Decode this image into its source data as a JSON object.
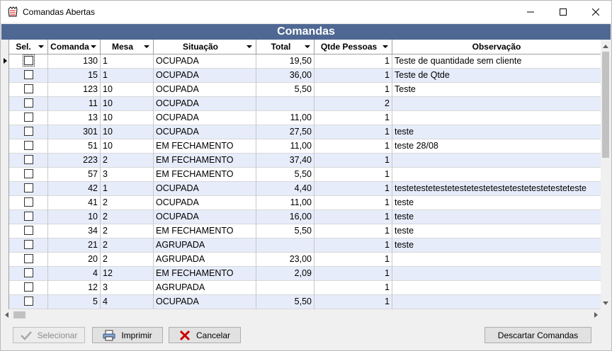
{
  "window": {
    "title": "Comandas Abertas",
    "minimize_glyph": "—",
    "maximize_glyph": "☐",
    "close_glyph": "✕"
  },
  "banner": {
    "title": "Comandas"
  },
  "grid": {
    "columns": [
      {
        "label": "Sel.",
        "dropdown": true
      },
      {
        "label": "Comanda",
        "dropdown": true
      },
      {
        "label": "Mesa",
        "dropdown": true
      },
      {
        "label": "Situação",
        "dropdown": true
      },
      {
        "label": "Total",
        "dropdown": true
      },
      {
        "label": "Qtde Pessoas",
        "dropdown": true
      },
      {
        "label": "Observação",
        "dropdown": false
      }
    ],
    "rows": [
      {
        "comanda": "130",
        "mesa": "1",
        "situacao": "OCUPADA",
        "total": "19,50",
        "pessoas": "1",
        "obs": "Teste de quantidade sem cliente"
      },
      {
        "comanda": "15",
        "mesa": "1",
        "situacao": "OCUPADA",
        "total": "36,00",
        "pessoas": "1",
        "obs": "Teste de Qtde"
      },
      {
        "comanda": "123",
        "mesa": "10",
        "situacao": "OCUPADA",
        "total": "5,50",
        "pessoas": "1",
        "obs": "Teste"
      },
      {
        "comanda": "11",
        "mesa": "10",
        "situacao": "OCUPADA",
        "total": "",
        "pessoas": "2",
        "obs": ""
      },
      {
        "comanda": "13",
        "mesa": "10",
        "situacao": "OCUPADA",
        "total": "11,00",
        "pessoas": "1",
        "obs": ""
      },
      {
        "comanda": "301",
        "mesa": "10",
        "situacao": "OCUPADA",
        "total": "27,50",
        "pessoas": "1",
        "obs": "teste"
      },
      {
        "comanda": "51",
        "mesa": "10",
        "situacao": "EM FECHAMENTO",
        "total": "11,00",
        "pessoas": "1",
        "obs": "teste 28/08"
      },
      {
        "comanda": "223",
        "mesa": "2",
        "situacao": "EM FECHAMENTO",
        "total": "37,40",
        "pessoas": "1",
        "obs": ""
      },
      {
        "comanda": "57",
        "mesa": "3",
        "situacao": "EM FECHAMENTO",
        "total": "5,50",
        "pessoas": "1",
        "obs": ""
      },
      {
        "comanda": "42",
        "mesa": "1",
        "situacao": "OCUPADA",
        "total": "4,40",
        "pessoas": "1",
        "obs": "testetestetestetestetestetestetestetestetesteteste"
      },
      {
        "comanda": "41",
        "mesa": "2",
        "situacao": "OCUPADA",
        "total": "11,00",
        "pessoas": "1",
        "obs": "teste"
      },
      {
        "comanda": "10",
        "mesa": "2",
        "situacao": "OCUPADA",
        "total": "16,00",
        "pessoas": "1",
        "obs": "teste"
      },
      {
        "comanda": "34",
        "mesa": "2",
        "situacao": "EM FECHAMENTO",
        "total": "5,50",
        "pessoas": "1",
        "obs": "teste"
      },
      {
        "comanda": "21",
        "mesa": "2",
        "situacao": "AGRUPADA",
        "total": "",
        "pessoas": "1",
        "obs": "teste"
      },
      {
        "comanda": "20",
        "mesa": "2",
        "situacao": "AGRUPADA",
        "total": "23,00",
        "pessoas": "1",
        "obs": ""
      },
      {
        "comanda": "4",
        "mesa": "12",
        "situacao": "EM FECHAMENTO",
        "total": "2,09",
        "pessoas": "1",
        "obs": ""
      },
      {
        "comanda": "12",
        "mesa": "3",
        "situacao": "AGRUPADA",
        "total": "",
        "pessoas": "1",
        "obs": ""
      },
      {
        "comanda": "5",
        "mesa": "4",
        "situacao": "OCUPADA",
        "total": "5,50",
        "pessoas": "1",
        "obs": ""
      }
    ]
  },
  "buttons": {
    "selecionar": "Selecionar",
    "imprimir": "Imprimir",
    "cancelar": "Cancelar",
    "descartar": "Descartar Comandas"
  },
  "colors": {
    "banner": "#4f6893",
    "row_alt": "#e6ecfa",
    "cancel_icon": "#cc0000"
  }
}
